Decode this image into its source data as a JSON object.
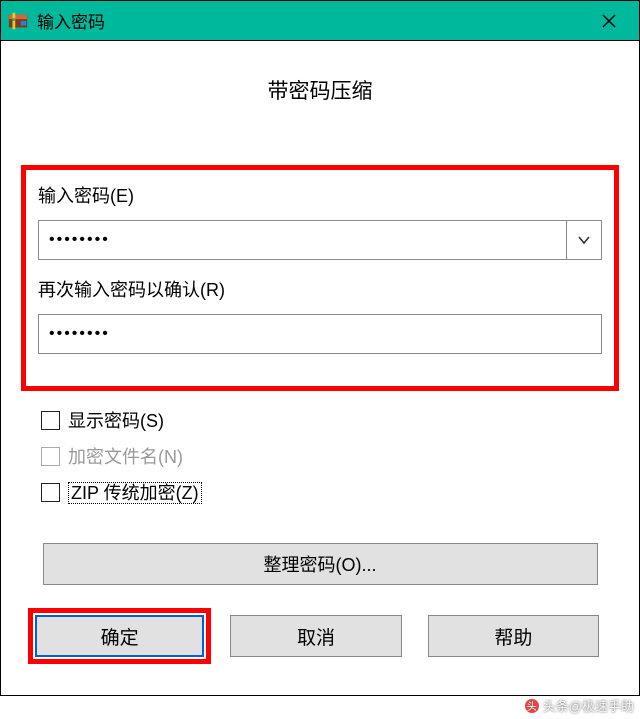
{
  "titlebar": {
    "title": "输入密码"
  },
  "main_heading": "带密码压缩",
  "password": {
    "label": "输入密码(E)",
    "value": "••••••••"
  },
  "confirm": {
    "label": "再次输入密码以确认(R)",
    "value": "••••••••"
  },
  "checkboxes": {
    "show_password": "显示密码(S)",
    "encrypt_names": "加密文件名(N)",
    "zip_legacy": "ZIP 传统加密(Z)"
  },
  "organize_button": "整理密码(O)...",
  "buttons": {
    "ok": "确定",
    "cancel": "取消",
    "help": "帮助"
  },
  "watermark": "头条@极速手助"
}
